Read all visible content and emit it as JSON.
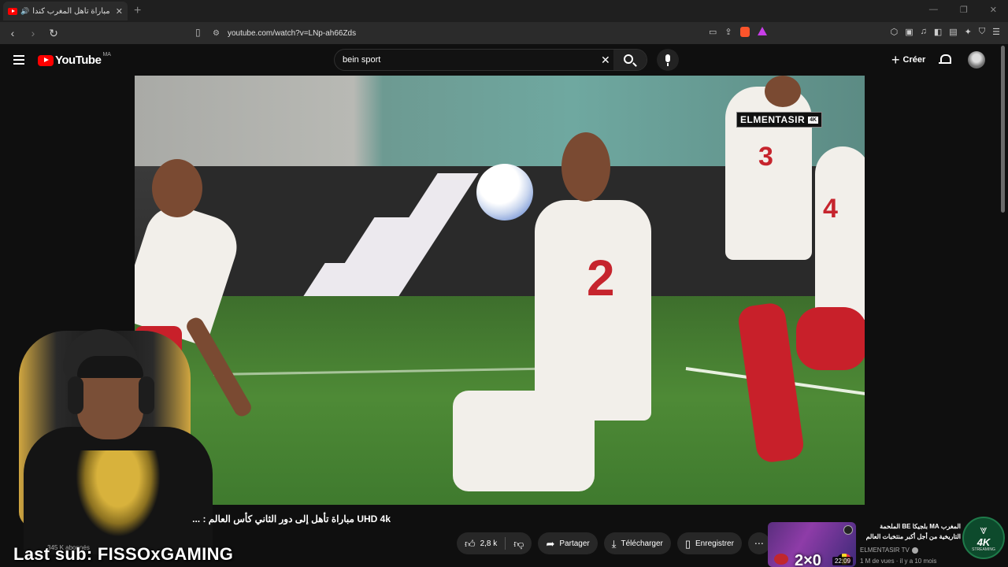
{
  "browser": {
    "tab_title": "مباراة تأهل المغرب كندا MA CA",
    "tab_close": "✕",
    "new_tab": "+",
    "url": "youtube.com/watch?v=LNp-ah66Zds",
    "window_controls": [
      "—",
      "❐",
      "✕"
    ]
  },
  "header": {
    "logo_text": "YouTube",
    "country_code": "MA",
    "search_query": "bein sport",
    "create_label": "Créer"
  },
  "video": {
    "watermark": "ELMENTASIR",
    "watermark_badge": "4K",
    "jersey_numbers": [
      "3",
      "2",
      "3",
      "4"
    ]
  },
  "overlay": {
    "last_sub": "Last sub: FISSOxGAMING",
    "sub_count": "345 K abonnés"
  },
  "watch": {
    "title": "UHD 4k مباراة تأهل إلى دور الثاني كأس العالم : ...",
    "like_count": "2,8 k",
    "share_label": "Partager",
    "download_label": "Télécharger",
    "save_label": "Enregistrer",
    "more_label": "⋯"
  },
  "related": {
    "title": "المغرب MA بلجيكا BE الملحمة التاريخية من أجل أكبر منتخبات العالم كأس العالم : وجنون خليل البلوشي جودة",
    "channel": "ELMENTASIR TV",
    "meta": "1 M de vues · il y a 10 mois",
    "score": "2×0",
    "duration": "22:09"
  },
  "logo": {
    "text": "4K",
    "subtext": "STREAMING"
  },
  "colors": {
    "accent": "#ff0000",
    "background": "#0f0f0f",
    "pill": "#272727"
  }
}
